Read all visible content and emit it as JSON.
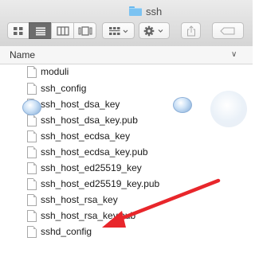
{
  "window": {
    "title": "ssh"
  },
  "toolbar": {
    "view_buttons": [
      {
        "icon": "icon-view-icon"
      },
      {
        "icon": "list-view-icon",
        "active": true
      },
      {
        "icon": "column-view-icon"
      },
      {
        "icon": "cover-flow-view-icon"
      }
    ],
    "arrange_icon": "arrange-grid-icon",
    "action_icon": "gear-icon",
    "share_icon": "share-icon",
    "tag_icon": "tag-icon"
  },
  "column_header": {
    "name_label": "Name"
  },
  "files": [
    {
      "name": "moduli"
    },
    {
      "name": "ssh_config"
    },
    {
      "name": "ssh_host_dsa_key"
    },
    {
      "name": "ssh_host_dsa_key.pub"
    },
    {
      "name": "ssh_host_ecdsa_key"
    },
    {
      "name": "ssh_host_ecdsa_key.pub"
    },
    {
      "name": "ssh_host_ed25519_key"
    },
    {
      "name": "ssh_host_ed25519_key.pub"
    },
    {
      "name": "ssh_host_rsa_key"
    },
    {
      "name": "ssh_host_rsa_key.pub"
    },
    {
      "name": "sshd_config"
    }
  ],
  "annotation": {
    "arrow_color": "#e8262b"
  },
  "colors": {
    "folder_blue": "#7cc3f2",
    "selected_segment": "#6c6c6c"
  }
}
